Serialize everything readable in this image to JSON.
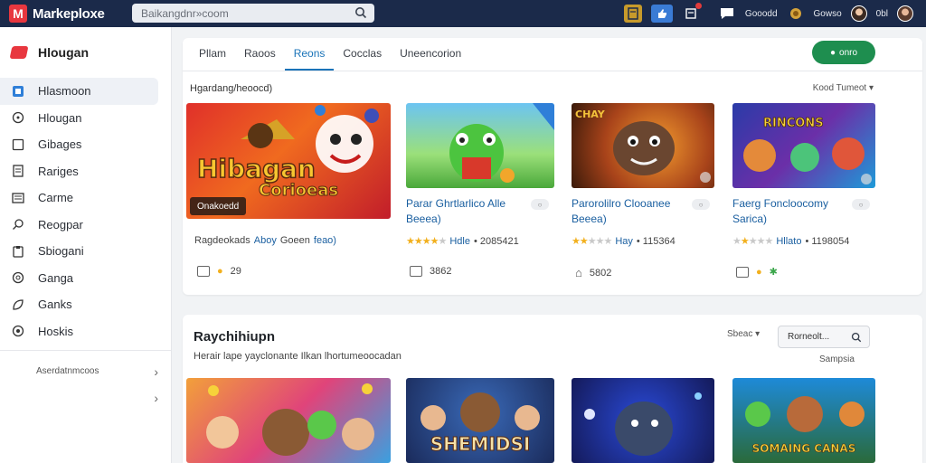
{
  "app": {
    "title": "Markeploxe",
    "logo_letter": "M"
  },
  "search": {
    "placeholder": "Baikangdnr»coom"
  },
  "topbar": {
    "user_a": "Gooodd",
    "user_b": "Gowso",
    "user_c": "0bl"
  },
  "sidebar": {
    "brand": "Hlougan",
    "items": [
      {
        "label": "Hlasmoon",
        "icon": "home-icon",
        "active": true
      },
      {
        "label": "Hlougan",
        "icon": "circle-icon"
      },
      {
        "label": "Gibages",
        "icon": "square-icon"
      },
      {
        "label": "Rariges",
        "icon": "document-icon"
      },
      {
        "label": "Carme",
        "icon": "list-icon"
      },
      {
        "label": "Reogpar",
        "icon": "search-icon"
      },
      {
        "label": "Sbiogani",
        "icon": "clipboard-icon"
      },
      {
        "label": "Ganga",
        "icon": "compass-icon"
      },
      {
        "label": "Ganks",
        "icon": "leaf-icon"
      },
      {
        "label": "Hoskis",
        "icon": "target-icon"
      }
    ],
    "footer": "Aserdatnmcoos"
  },
  "main": {
    "tabs": [
      "Pllam",
      "Raoos",
      "Reons",
      "Cocclas",
      "Uneencorion"
    ],
    "active_tab": 2,
    "cta_label": "onro",
    "subtitle": "Hgardang/heoocd)",
    "sort_label": "Kood Tumeot",
    "games": [
      {
        "title": "",
        "caption": "Onakoedd",
        "meta_text": "Ragdeokads",
        "rate_text": "Aboy",
        "extra": "Goeen",
        "extra2": "feao)",
        "footer_value": "29",
        "art": "Hibagan Corioeas"
      },
      {
        "title": "Parar Ghrtlarlico Alle",
        "title2": "Beeea)",
        "rate_text": "Hdle",
        "rating": 4,
        "count": "• 2085421",
        "footer_value": "3862"
      },
      {
        "title": "Parorolilro Clooanee",
        "title2": "Beeea)",
        "rate_text": "Hay",
        "rating": 2,
        "count": "• 115364",
        "footer_value": "5802"
      },
      {
        "title": "Faerg Foncloocomy",
        "title2": "Sarica)",
        "rate_text": "Hllato",
        "rating": 2,
        "count": "• 1198054",
        "footer_value": ""
      }
    ],
    "section2": {
      "title": "Raychihiupn",
      "subtitle": "Herair lape yayclonante Ilkan lhortumeoocadan",
      "sort_label": "Sbeac",
      "search_placeholder": "Rorneolt...",
      "samples_label": "Sampsia",
      "thumb_texts": [
        "",
        "SHEMIDSI",
        "",
        "SOMAING CANAS"
      ]
    }
  },
  "colors": {
    "topbar": "#1b2a4a",
    "accent": "#1a73b8",
    "cta": "#1e8e4f",
    "brand": "#e8373f"
  }
}
